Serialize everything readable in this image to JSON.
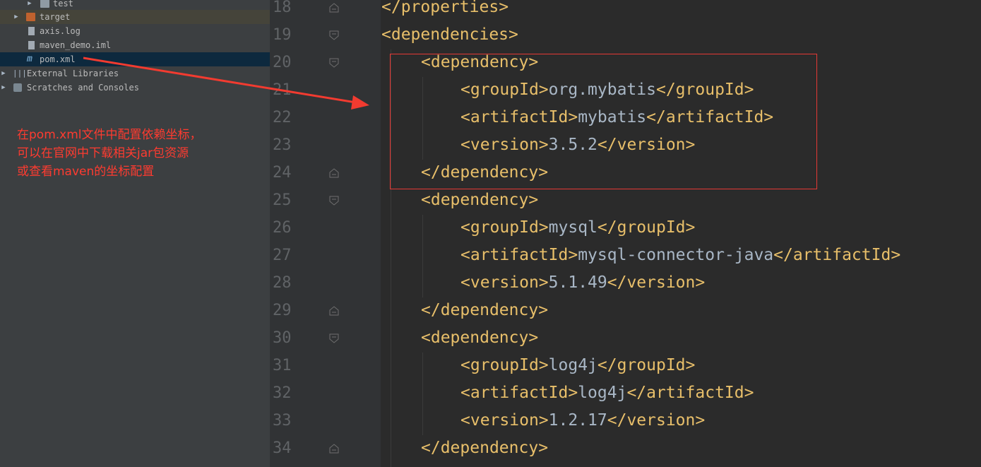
{
  "sidebar": {
    "items": [
      {
        "label": "test"
      },
      {
        "label": "target"
      },
      {
        "label": "axis.log"
      },
      {
        "label": "maven_demo.iml"
      },
      {
        "label": "pom.xml"
      },
      {
        "label": "External Libraries"
      },
      {
        "label": "Scratches and Consoles"
      }
    ]
  },
  "annotation": {
    "text": "在pom.xml文件中配置依赖坐标，\n可以在官网中下载相关jar包资源\n或查看maven的坐标配置"
  },
  "editor": {
    "lines": [
      {
        "num": "18",
        "open": "</",
        "name": "properties",
        "close": ">",
        "value": "",
        "end": ""
      },
      {
        "num": "19",
        "open": "<",
        "name": "dependencies",
        "close": ">",
        "value": "",
        "end": ""
      },
      {
        "num": "20",
        "open": "<",
        "name": "dependency",
        "close": ">",
        "value": "",
        "end": ""
      },
      {
        "num": "21",
        "open": "<",
        "name": "groupId",
        "close": ">",
        "value": "org.mybatis",
        "end": "</groupId>"
      },
      {
        "num": "22",
        "open": "<",
        "name": "artifactId",
        "close": ">",
        "value": "mybatis",
        "end": "</artifactId>"
      },
      {
        "num": "23",
        "open": "<",
        "name": "version",
        "close": ">",
        "value": "3.5.2",
        "end": "</version>"
      },
      {
        "num": "24",
        "open": "</",
        "name": "dependency",
        "close": ">",
        "value": "",
        "end": ""
      },
      {
        "num": "25",
        "open": "<",
        "name": "dependency",
        "close": ">",
        "value": "",
        "end": ""
      },
      {
        "num": "26",
        "open": "<",
        "name": "groupId",
        "close": ">",
        "value": "mysql",
        "end": "</groupId>"
      },
      {
        "num": "27",
        "open": "<",
        "name": "artifactId",
        "close": ">",
        "value": "mysql-connector-java",
        "end": "</artifactId>"
      },
      {
        "num": "28",
        "open": "<",
        "name": "version",
        "close": ">",
        "value": "5.1.49",
        "end": "</version>"
      },
      {
        "num": "29",
        "open": "</",
        "name": "dependency",
        "close": ">",
        "value": "",
        "end": ""
      },
      {
        "num": "30",
        "open": "<",
        "name": "dependency",
        "close": ">",
        "value": "",
        "end": ""
      },
      {
        "num": "31",
        "open": "<",
        "name": "groupId",
        "close": ">",
        "value": "log4j",
        "end": "</groupId>"
      },
      {
        "num": "32",
        "open": "<",
        "name": "artifactId",
        "close": ">",
        "value": "log4j",
        "end": "</artifactId>"
      },
      {
        "num": "33",
        "open": "<",
        "name": "version",
        "close": ">",
        "value": "1.2.17",
        "end": "</version>"
      },
      {
        "num": "34",
        "open": "</",
        "name": "dependency",
        "close": ">",
        "value": "",
        "end": ""
      }
    ]
  },
  "colors": {
    "tag": "#e8bf6a",
    "text": "#a9b7c6",
    "line_number": "#606366",
    "annotation": "#ff3b30",
    "highlight_box": "#e53935"
  }
}
